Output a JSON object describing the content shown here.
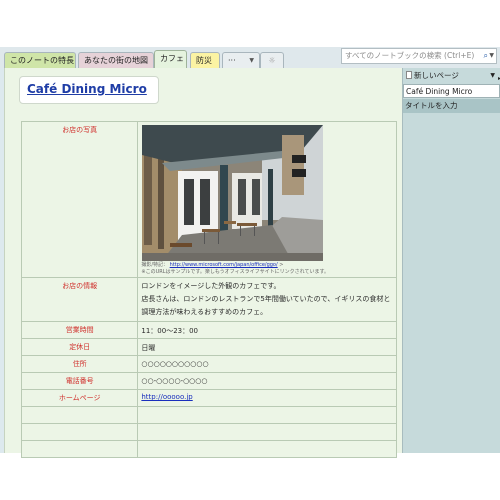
{
  "tabs": [
    {
      "label": "このノートの特長"
    },
    {
      "label": "あなたの街の地図"
    },
    {
      "label": "カフェ"
    },
    {
      "label": "防災"
    },
    {
      "label": "···"
    },
    {
      "label": "☼"
    }
  ],
  "search": {
    "placeholder": "すべてのノートブックの検索 (Ctrl+E)"
  },
  "page": {
    "title": "Café Dining Micro",
    "rows": [
      {
        "label": "お店の写真",
        "caption_prefix": "撮影/特記：",
        "caption_link": "http://www.microsoft.com/japan/office/ggo/",
        "caption_suffix": ">",
        "caption_note": "※このURLはサンプルです。楽しもうオフィスライフサイトにリンクされています。"
      },
      {
        "label": "お店の情報",
        "lines": [
          "ロンドンをイメージした外観のカフェです。",
          "店長さんは、ロンドンのレストランで5年間働いていたので、イギリスの食材と調理方法が味わえるおすすめのカフェ。"
        ]
      },
      {
        "label": "営業時間",
        "value": "11：00～23：00"
      },
      {
        "label": "定休日",
        "value": "日曜"
      },
      {
        "label": "住所",
        "value": "○○○○○○○○○○○"
      },
      {
        "label": "電話番号",
        "value": "○○-○○○○-○○○○"
      },
      {
        "label": "ホームページ",
        "value": "http://ooooo.jp"
      }
    ]
  },
  "pages_pane": {
    "new_page_label": "新しいページ",
    "items": [
      {
        "label": "Café Dining Micro",
        "selected": true
      },
      {
        "label": "タイトルを入力",
        "selected": false
      }
    ]
  },
  "colors": {
    "label_red": "#d0312d",
    "title_blue": "#1f3da6",
    "page_bg": "#ecf5e6",
    "pane_bg": "#c6dadb"
  }
}
